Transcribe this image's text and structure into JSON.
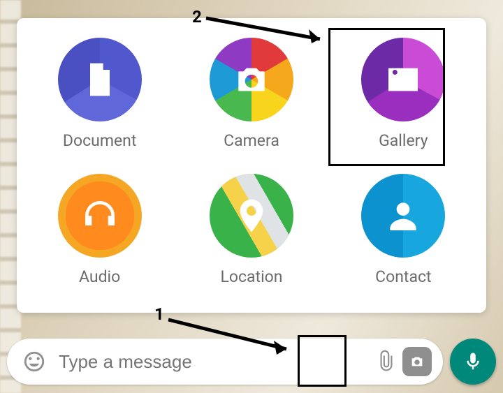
{
  "attach_panel": {
    "items": [
      {
        "label": "Document"
      },
      {
        "label": "Camera"
      },
      {
        "label": "Gallery"
      },
      {
        "label": "Audio"
      },
      {
        "label": "Location"
      },
      {
        "label": "Contact"
      }
    ]
  },
  "input": {
    "placeholder": "Type a message"
  },
  "annotations": {
    "step1": "1",
    "step2": "2"
  }
}
